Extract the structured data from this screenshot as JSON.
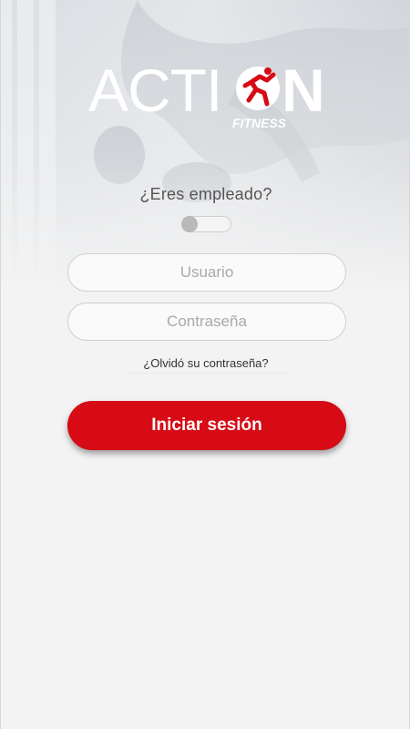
{
  "brand": {
    "logo_text": "ACTION",
    "logo_sub": "FITNESS",
    "accent_color": "#d60b15"
  },
  "login": {
    "employee_question": "¿Eres empleado?",
    "employee_toggle_on": false,
    "username_placeholder": "Usuario",
    "password_placeholder": "Contraseña",
    "forgot_password": "¿Olvidó su contraseña?",
    "submit_label": "Iniciar sesión"
  }
}
